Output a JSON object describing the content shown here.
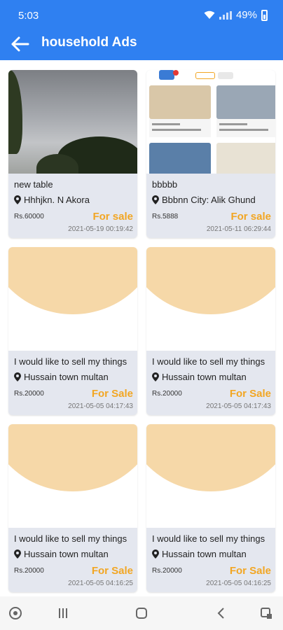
{
  "status_bar": {
    "time": "5:03",
    "battery": "49%"
  },
  "app_bar": {
    "title": "household Ads",
    "back_icon": "arrow-left-icon"
  },
  "ads": [
    {
      "name": "new table",
      "location": "Hhhjkn. N Akora",
      "price": "Rs.60000",
      "status": "For sale",
      "date": "2021-05-19 00:19:42"
    },
    {
      "name": "bbbbb",
      "location": "Bbbnn City: Alik Ghund",
      "price": "Rs.5888",
      "status": "For sale",
      "date": "2021-05-11 06:29:44"
    },
    {
      "name": "I would like to sell my things",
      "location": "Hussain town  multan",
      "price": "Rs.20000",
      "status": "For Sale",
      "date": "2021-05-05 04:17:43"
    },
    {
      "name": "I would like to sell my things",
      "location": "Hussain town  multan",
      "price": "Rs.20000",
      "status": "For Sale",
      "date": "2021-05-05 04:17:43"
    },
    {
      "name": "I would like to sell my things",
      "location": "Hussain town  multan",
      "price": "Rs.20000",
      "status": "For Sale",
      "date": "2021-05-05 04:16:25"
    },
    {
      "name": "I would like to sell my things",
      "location": "Hussain town  multan",
      "price": "Rs.20000",
      "status": "For Sale",
      "date": "2021-05-05 04:16:25"
    }
  ],
  "colors": {
    "primary": "#2f80f1",
    "accent": "#f2a623",
    "card_bg": "#e4e7ef",
    "placeholder": "#f6d8a8"
  },
  "nav_icons": [
    "app-launcher-icon",
    "recent-apps-icon",
    "home-icon",
    "back-icon",
    "screenshot-icon"
  ]
}
